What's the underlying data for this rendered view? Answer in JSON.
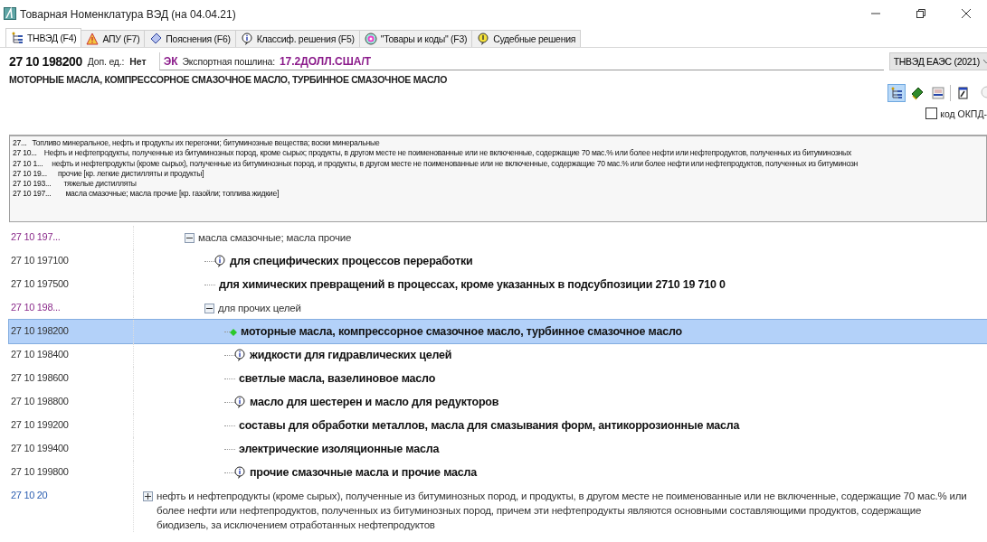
{
  "window": {
    "title": "Товарная Номенклатура ВЭД (на 04.04.21)"
  },
  "tabs": [
    {
      "label": "ТНВЭД (F4)",
      "selected": true
    },
    {
      "label": "АПУ (F7)",
      "selected": false
    },
    {
      "label": "Пояснения (F6)",
      "selected": false
    },
    {
      "label": "Классиф. решения (F5)",
      "selected": false
    },
    {
      "label": "\"Товары и коды\" (F3)",
      "selected": false
    },
    {
      "label": "Судебные решения",
      "selected": false
    }
  ],
  "header": {
    "code": "27 10 198200",
    "extra_unit_label": "Доп. ед.:",
    "extra_unit_value": "Нет",
    "duty_tag": "ЭК",
    "duty_label": "Экспортная пошлина:",
    "duty_value": "17.2ДОЛЛ.США/Т",
    "edition": "ТНВЭД ЕАЭС (2021)",
    "description": "МОТОРНЫЕ МАСЛА, КОМПРЕССОРНОЕ СМАЗОЧНОЕ МАСЛО, ТУРБИННОЕ СМАЗОЧНОЕ МАСЛО"
  },
  "toolbar": [
    {
      "selected": true
    },
    {
      "selected": false
    },
    {
      "selected": false
    },
    {
      "selected": false
    },
    {
      "selected": false
    }
  ],
  "okpd_checkbox": {
    "label": "код ОКПД-",
    "checked": false
  },
  "breadcrumb": [
    {
      "code": "27...",
      "text": "Топливо минеральное, нефть и продукты их перегонки; битуминозные вещества; воски минеральные"
    },
    {
      "code": "27 10...",
      "text": "Нефть и нефтепродукты, полученные из битуминозных пород, кроме сырых; продукты, в другом месте не поименованные или не включенные, содержащие 70 мас.% или более нефти или нефтепродуктов, полученных из битуминозных"
    },
    {
      "code": "27 10 1...",
      "text": "нефть и нефтепродукты (кроме сырых), полученные из битуминозных пород, и продукты, в другом месте не поименованные или не включенные, содержащие 70 мас.% или более нефти или нефтепродуктов, полученных из битуминозн"
    },
    {
      "code": "27 10 19...",
      "text": "прочие [кр. легкие дистилляты и продукты]"
    },
    {
      "code": "27 10 193...",
      "text": "тяжелые дистилляты"
    },
    {
      "code": "27 10 197...",
      "text": "масла смазочные; масла прочие [кр. газойли; топлива жидкие]"
    }
  ],
  "tree": [
    {
      "kind": "group",
      "code": "27 10 197...",
      "text": "масла смазочные; масла прочие",
      "expanded": true,
      "selected": false,
      "children": [
        {
          "kind": "leaf",
          "code": "27 10 197100",
          "text": "для специфических процессов переработки",
          "info": true,
          "selected": false
        },
        {
          "kind": "leaf",
          "code": "27 10 197500",
          "text": "для химических превращений в процессах, кроме указанных в подсубпозиции 2710 19 710 0",
          "info": false,
          "selected": false
        },
        {
          "kind": "group",
          "code": "27 10 198...",
          "text": "для прочих целей",
          "expanded": true,
          "selected": false,
          "children": [
            {
              "kind": "leaf",
              "code": "27 10 198200",
              "text": "моторные масла, компрессорное смазочное масло, турбинное смазочное масло",
              "info": false,
              "selected": true
            },
            {
              "kind": "leaf",
              "code": "27 10 198400",
              "text": "жидкости для гидравлических целей",
              "info": true,
              "selected": false
            },
            {
              "kind": "leaf",
              "code": "27 10 198600",
              "text": "светлые масла, вазелиновое масло",
              "info": false,
              "selected": false
            },
            {
              "kind": "leaf",
              "code": "27 10 198800",
              "text": "масло для шестерен и масло для редукторов",
              "info": true,
              "selected": false
            },
            {
              "kind": "leaf",
              "code": "27 10 199200",
              "text": "составы для обработки металлов, масла для смазывания форм, антикоррозионные масла",
              "info": false,
              "selected": false
            },
            {
              "kind": "leaf",
              "code": "27 10 199400",
              "text": "электрические изоляционные масла",
              "info": false,
              "selected": false
            },
            {
              "kind": "leaf",
              "code": "27 10 199800",
              "text": "прочие смазочные масла и прочие масла",
              "info": true,
              "selected": false
            }
          ]
        }
      ]
    },
    {
      "kind": "collapsed",
      "code": "27 10 20",
      "text": "нефть и нефтепродукты (кроме сырых), полученные из битуминозных пород, и продукты, в другом месте не поименованные или не включенные, содержащие 70 мас.% или более нефти или нефтепродуктов, полученных из битуминозных пород, причем эти нефтепродукты являются основными составляющими продуктов, содержащие биодизель, за исключением отработанных нефтепродуктов",
      "expanded": false,
      "selected": false
    }
  ]
}
